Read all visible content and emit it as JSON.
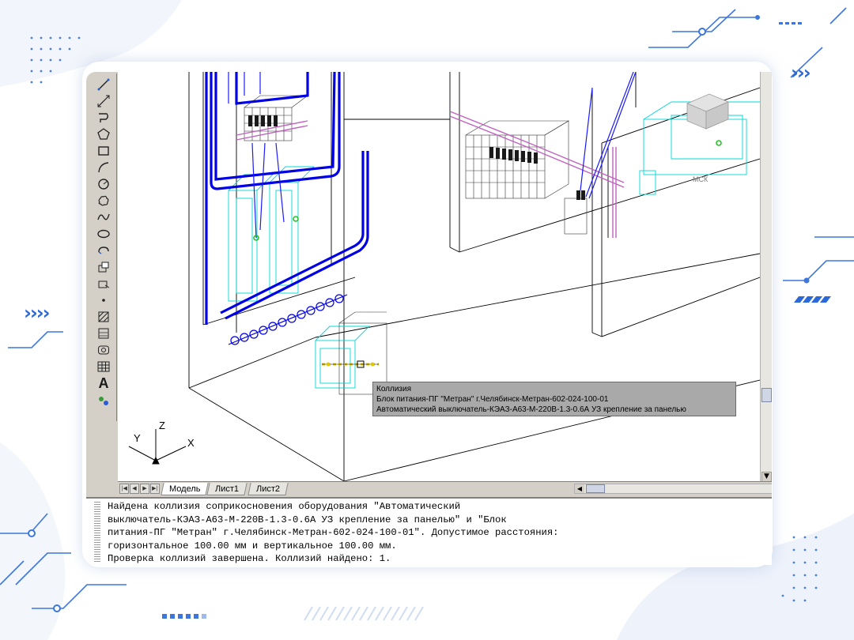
{
  "drawing": {
    "tabs": [
      "Модель",
      "Лист1",
      "Лист2"
    ],
    "active_tab": "Модель",
    "ucs_axes": {
      "x": "X",
      "y": "Y",
      "z": "Z"
    },
    "viewcube_label": "МСК"
  },
  "collision_tooltip": {
    "title": "Коллизия",
    "item_1": "Блок питания-ПГ \"Метран\" г.Челябинск-Метран-602-024-100-01",
    "item_2": "Автоматический выключатель-КЭАЗ-А63-М-220В-1.3-0.6А УЗ крепление за панелью"
  },
  "command_line": {
    "lines": [
      "Найдена коллизия соприкосновения оборудования \"Автоматический",
      "выключатель-КЭАЗ-А63-М-220В-1.3-0.6А УЗ крепление за панелью\" и \"Блок",
      "питания-ПГ \"Метран\" г.Челябинск-Метран-602-024-100-01\". Допустимое расстояния:",
      "горизонтальное 100.00 мм и вертикальное 100.00 мм.",
      "Проверка коллизий завершена. Коллизий найдено: 1."
    ]
  },
  "toolbar_icons": [
    "line-icon",
    "construction-line-icon",
    "polyline-icon",
    "polygon-icon",
    "rectangle-icon",
    "arc-icon",
    "circle-icon",
    "revision-cloud-icon",
    "spline-icon",
    "ellipse-icon",
    "ellipse-arc-icon",
    "insert-block-icon",
    "make-block-icon",
    "point-icon",
    "hatch-icon",
    "gradient-icon",
    "region-icon",
    "table-icon",
    "multiline-text-icon",
    "add-selected-icon"
  ],
  "decor": {
    "chevrons_right": "›››",
    "chevrons_left": "››››",
    "colors": {
      "accent": "#2b68d8",
      "cad_blue": "#0000ff",
      "cyan": "#00e5e5",
      "magenta": "#cc66cc"
    }
  }
}
